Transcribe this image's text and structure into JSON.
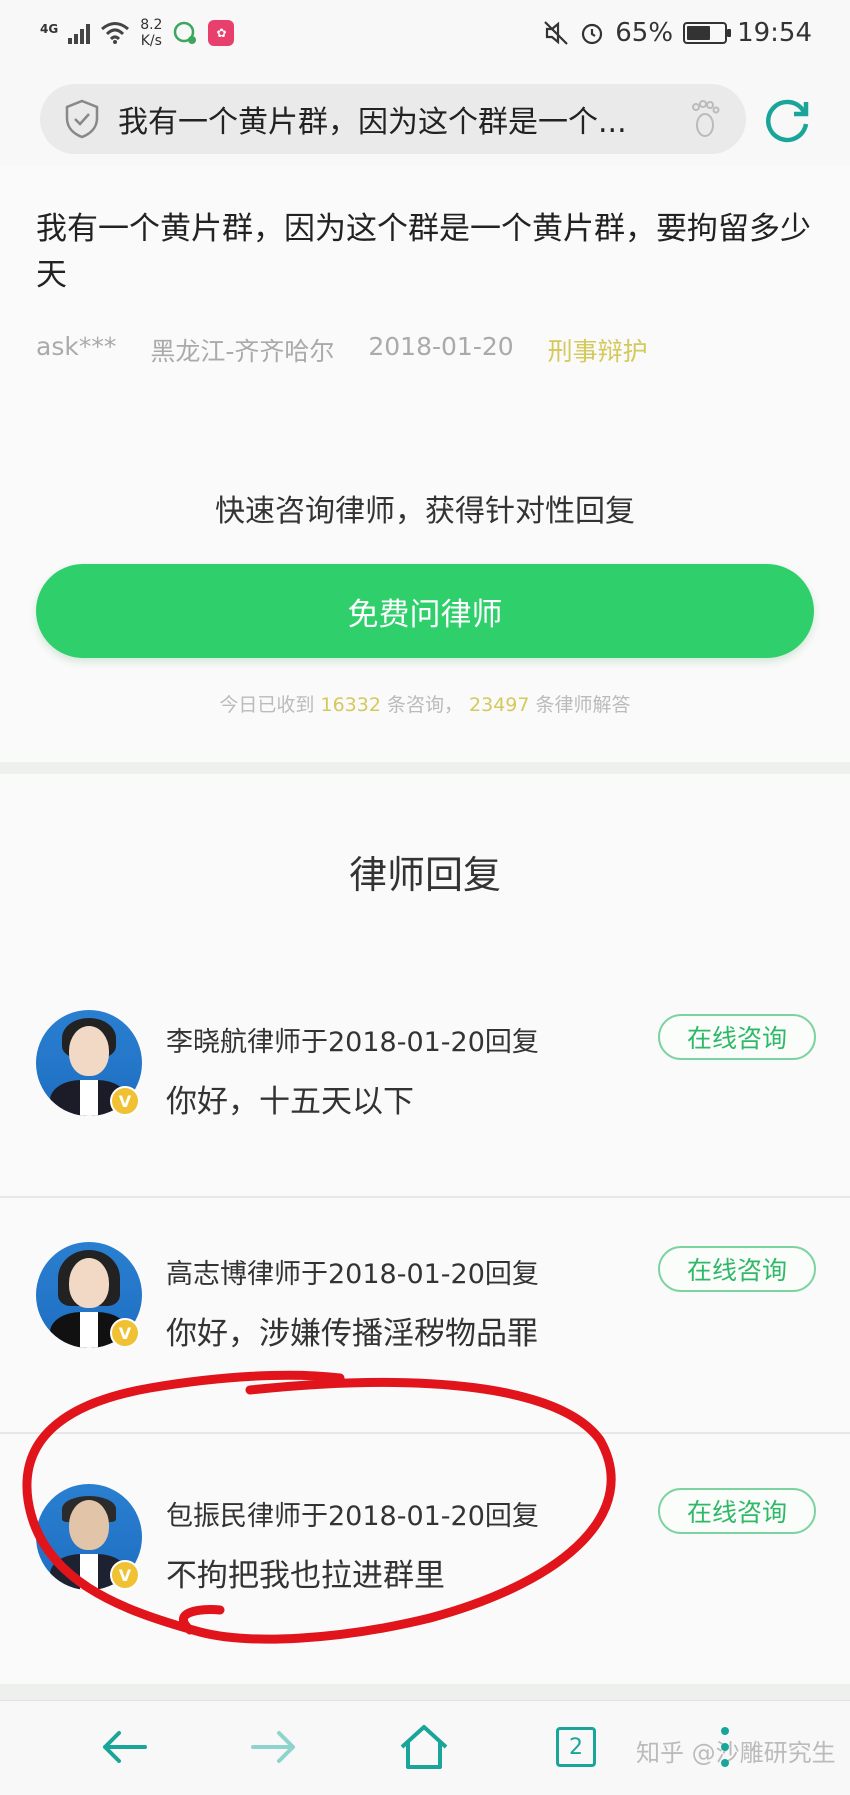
{
  "status_bar": {
    "network": "4G",
    "speed_value": "8.2",
    "speed_unit": "K/s",
    "battery_percent": "65%",
    "battery_level": 0.65,
    "time": "19:54"
  },
  "search": {
    "query": "我有一个黄片群，因为这个群是一个..."
  },
  "question": {
    "title": "我有一个黄片群，因为这个群是一个黄片群，要拘留多少天",
    "user": "ask***",
    "location": "黑龙江-齐齐哈尔",
    "date": "2018-01-20",
    "tag": "刑事辩护"
  },
  "cta": {
    "title": "快速咨询律师，获得针对性回复",
    "button_label": "免费问律师",
    "note_prefix": "今日已收到",
    "consult_count": "16332",
    "note_mid": "条咨询，",
    "answer_count": "23497",
    "note_suffix": "条律师解答"
  },
  "replies": {
    "section_title": "律师回复",
    "consult_label": "在线咨询",
    "badge": "V",
    "items": [
      {
        "head": "李晓航律师于2018-01-20回复",
        "body": "你好，十五天以下"
      },
      {
        "head": "高志博律师于2018-01-20回复",
        "body": "你好，涉嫌传播淫秽物品罪"
      },
      {
        "head": "包振民律师于2018-01-20回复",
        "body": "不拘把我也拉进群里"
      }
    ]
  },
  "bottom_nav": {
    "tab_count": "2",
    "watermark": "知乎 @沙雕研究生"
  },
  "colors": {
    "accent_green": "#2fcf6c",
    "highlight_yellow": "#d4c95c",
    "annotation_red": "#e0141a",
    "nav_teal": "#1aa59b"
  }
}
